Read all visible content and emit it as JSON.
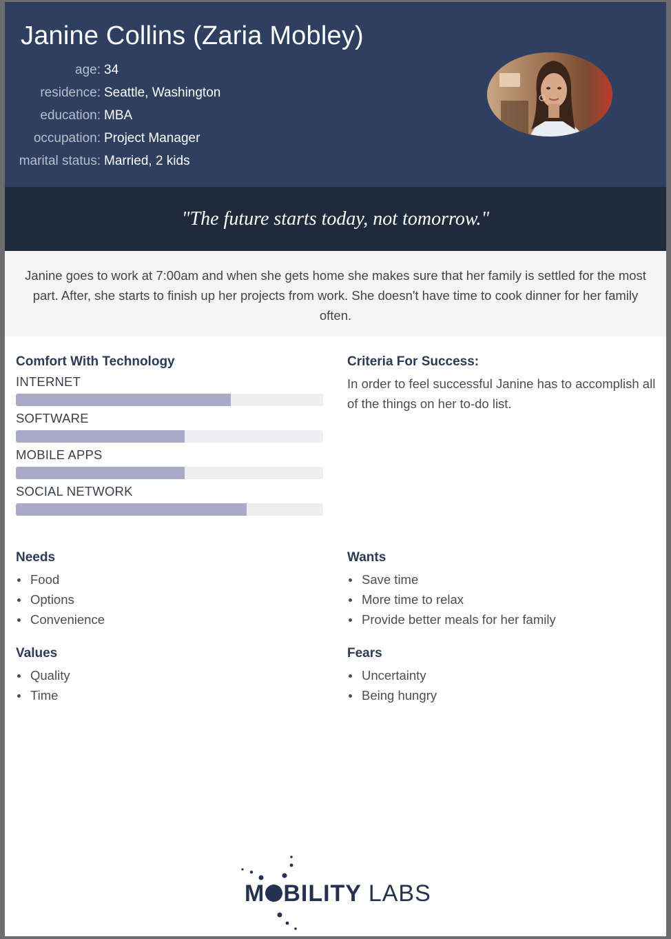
{
  "persona": {
    "name": "Janine Collins (Zaria Mobley)",
    "attributes": [
      {
        "label": "age:",
        "value": "34"
      },
      {
        "label": "residence:",
        "value": "Seattle, Washington"
      },
      {
        "label": "education:",
        "value": "MBA"
      },
      {
        "label": "occupation:",
        "value": "Project Manager"
      },
      {
        "label": "marital status:",
        "value": "Married, 2 kids"
      }
    ],
    "photo_icon": "portrait-photo"
  },
  "quote": "\"The future starts today, not tomorrow.\"",
  "bio": "Janine goes to work at 7:00am and when she gets home she makes sure that her family is settled for the most part. After, she starts to finish up her projects from work. She doesn't have time to cook dinner for her family often.",
  "technology": {
    "heading": "Comfort With Technology",
    "bars": [
      {
        "label": "INTERNET",
        "level": 0.7
      },
      {
        "label": "SOFTWARE",
        "level": 0.55
      },
      {
        "label": "MOBILE APPS",
        "level": 0.55
      },
      {
        "label": "SOCIAL NETWORK",
        "level": 0.75
      }
    ]
  },
  "criteria": {
    "heading": "Criteria For Success:",
    "text": "In order to feel successful Janine has to accomplish all of the things on her to-do list."
  },
  "needs": {
    "heading": "Needs",
    "items": [
      "Food",
      "Options",
      "Convenience"
    ]
  },
  "wants": {
    "heading": "Wants",
    "items": [
      "Save time",
      "More time to relax",
      "Provide better meals for her family"
    ]
  },
  "values": {
    "heading": "Values",
    "items": [
      "Quality",
      "Time"
    ]
  },
  "fears": {
    "heading": "Fears",
    "items": [
      "Uncertainty",
      "Being hungry"
    ]
  },
  "logo": {
    "part1": "M",
    "part2": "BILITY",
    "part3": "LABS"
  },
  "colors": {
    "header": "#2f3f5f",
    "quote_band": "#1f2a3b",
    "bar_fill": "#a9a9c8",
    "bar_track": "#eeeef0"
  }
}
